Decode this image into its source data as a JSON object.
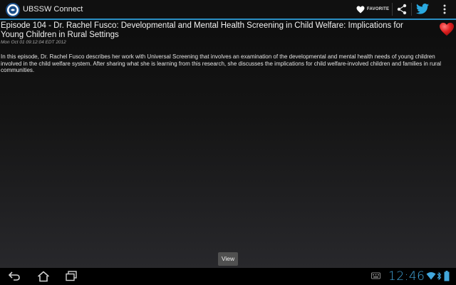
{
  "app": {
    "title": "UBSSW Connect"
  },
  "actionbar": {
    "favorite_label": "FAVORITE"
  },
  "episode": {
    "title": "Episode 104 - Dr. Rachel Fusco: Developmental and Mental Health Screening in Child Welfare: Implications for Young Children in Rural Settings",
    "date": "Mon Oct 01 09:12:04 EDT 2012",
    "description": "In this episode, Dr. Rachel Fusco describes her work with Universal Screening that involves an examination of the developmental and mental health needs of young children involved in the child welfare system. After sharing what she is learning from this research, she discusses the implications for child welfare-involved children and families in rural communities."
  },
  "view_button_label": "View",
  "system_bar": {
    "time": "12:46"
  },
  "colors": {
    "accent": "#2b8fc4",
    "clock": "#42a7dc",
    "heart": "#e02020",
    "twitter": "#2aa9e0"
  }
}
